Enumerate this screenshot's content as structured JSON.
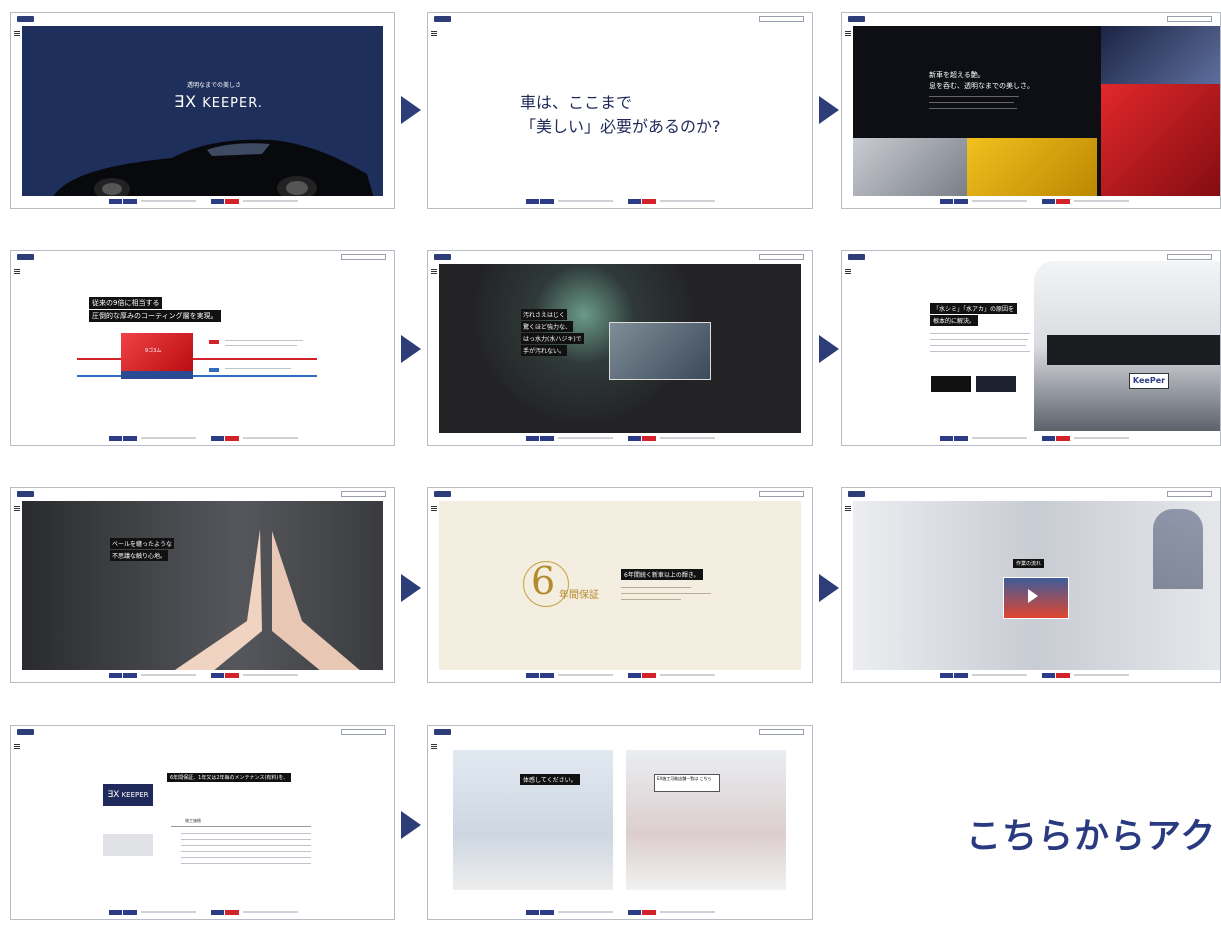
{
  "slide1": {
    "tagline": "透明なまでの美しさ",
    "logo": "KEEPER."
  },
  "slide2": {
    "headline_line1": "車は、ここまで",
    "headline_line2": "「美しい」必要があるのか?"
  },
  "slide3": {
    "line1": "新車を超える艶。",
    "line2": "息を呑む、透明なまでの美しさ。"
  },
  "slide4": {
    "line1": "従来の9倍",
    "line1_rest": "に相当する",
    "line2": "圧倒的な厚みのコーティング層を実現。",
    "box_label": "9ゴ3ム"
  },
  "slide5": {
    "line1": "汚れさえはじく",
    "line2": "驚くほど強力な、",
    "line3": "はっ水力(水ハジキ)で",
    "line4": "手が汚れない。"
  },
  "slide6": {
    "line1": "「水シミ」「水アカ」の原因を",
    "line2": "根本的に解決。",
    "badge": "KeePer"
  },
  "slide7": {
    "line1": "ベールを纏ったような",
    "line2": "不思議な触り心地。"
  },
  "slide8": {
    "seal_number": "6",
    "seal_text": "年間保証",
    "headline": "6年間続く新車以上の輝き。"
  },
  "slide9": {
    "label": "作業の流れ"
  },
  "slide10": {
    "headline": "6年間保証、1年又は2年毎のメンテナンス(有料)を、",
    "logo": "KEEPER",
    "table_header": "施工価格"
  },
  "slide11": {
    "headline": "体感してください。",
    "side": "EX施工可能店舗一覧は こちら"
  },
  "cta": "こちらからアク・"
}
